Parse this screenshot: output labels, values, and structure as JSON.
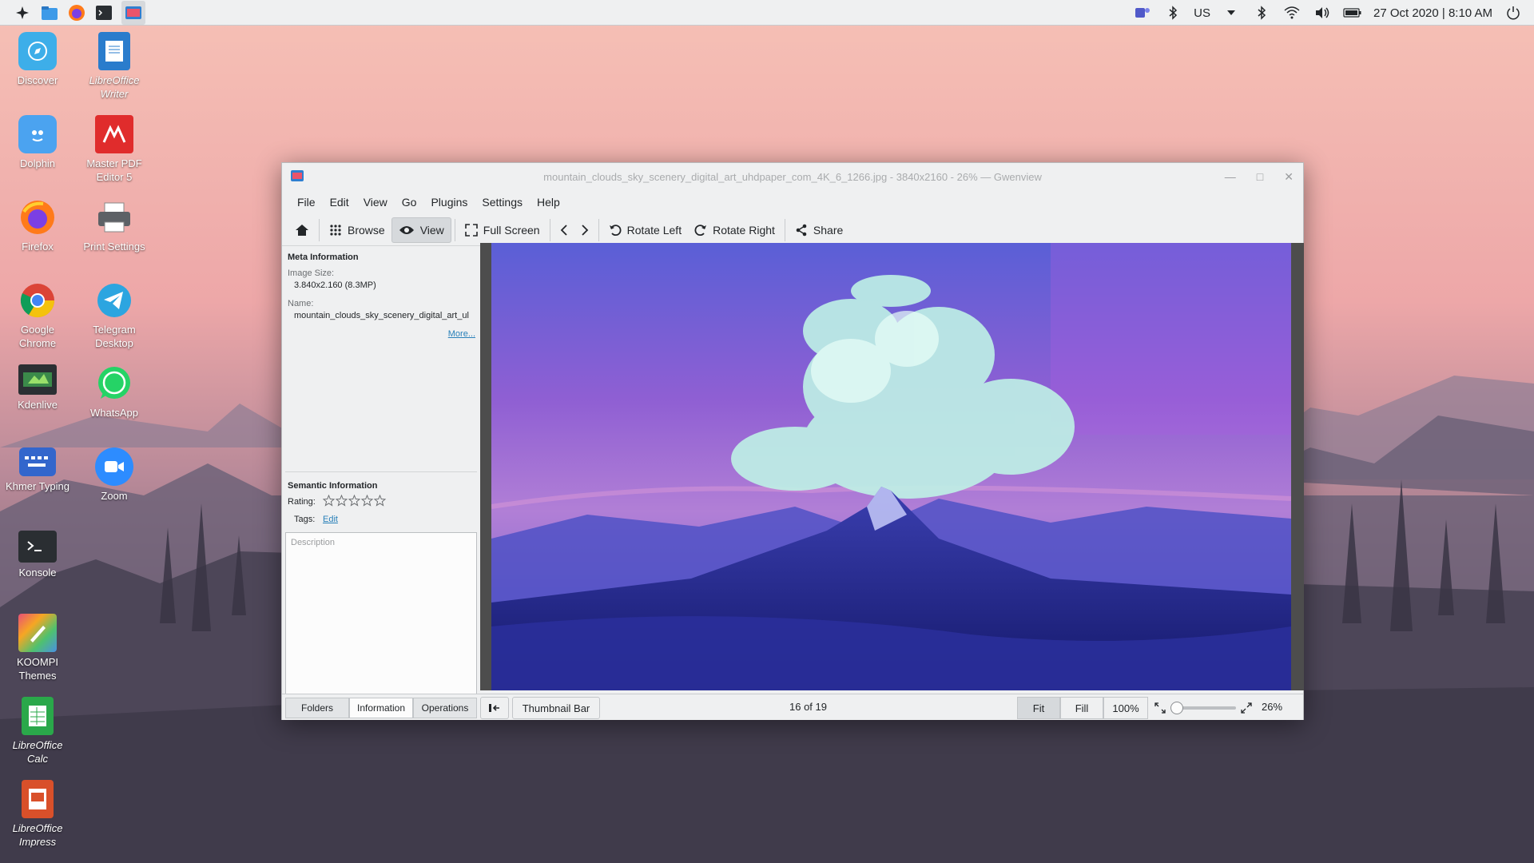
{
  "panel": {
    "launchers": [
      "application-launcher-icon",
      "dolphin-icon",
      "firefox-icon",
      "terminal-icon",
      "gwenview-icon"
    ],
    "keyboard_layout": "US",
    "datetime": "27 Oct 2020 | 8:10 AM"
  },
  "desktop": {
    "icons": [
      {
        "label": "Discover",
        "italic": false
      },
      {
        "label": "LibreOffice Writer",
        "italic": true
      },
      {
        "label": "Dolphin",
        "italic": false
      },
      {
        "label": "Master PDF Editor 5",
        "italic": false
      },
      {
        "label": "Firefox",
        "italic": false
      },
      {
        "label": "Print Settings",
        "italic": false
      },
      {
        "label": "Google Chrome",
        "italic": false
      },
      {
        "label": "Telegram Desktop",
        "italic": false
      },
      {
        "label": "Kdenlive",
        "italic": false
      },
      {
        "label": "WhatsApp",
        "italic": false
      },
      {
        "label": "Khmer Typing",
        "italic": false
      },
      {
        "label": "Zoom",
        "italic": false
      },
      {
        "label": "Konsole",
        "italic": false
      },
      {
        "label": "KOOMPI Themes",
        "italic": false
      },
      {
        "label": "LibreOffice Calc",
        "italic": true
      },
      {
        "label": "LibreOffice Impress",
        "italic": true
      }
    ]
  },
  "window": {
    "title": "mountain_clouds_sky_scenery_digital_art_uhdpaper_com_4K_6_1266.jpg - 3840x2160 - 26% — Gwenview",
    "menu": [
      "File",
      "Edit",
      "View",
      "Go",
      "Plugins",
      "Settings",
      "Help"
    ],
    "toolbar": {
      "browse": "Browse",
      "view": "View",
      "fullscreen": "Full Screen",
      "rotate_left": "Rotate Left",
      "rotate_right": "Rotate Right",
      "share": "Share"
    }
  },
  "sidebar": {
    "meta_title": "Meta Information",
    "image_size_label": "Image Size:",
    "image_size_value": "3.840x2.160 (8.3MP)",
    "name_label": "Name:",
    "name_value": "mountain_clouds_sky_scenery_digital_art_ul",
    "more_link": "More...",
    "semantic_title": "Semantic Information",
    "rating_label": "Rating:",
    "rating_value": 0,
    "rating_max": 5,
    "tags_label": "Tags:",
    "tags_edit": "Edit",
    "description_placeholder": "Description",
    "tabs": [
      "Folders",
      "Information",
      "Operations"
    ],
    "active_tab": "Information"
  },
  "statusbar": {
    "thumbnail_bar": "Thumbnail Bar",
    "position": "16 of 19",
    "fit": "Fit",
    "fill": "Fill",
    "hundred": "100%",
    "zoom": "26%",
    "zoom_slider_fraction": 0.0
  },
  "colors": {
    "accent": "#2980b9",
    "panel_bg": "#eff0f1"
  }
}
